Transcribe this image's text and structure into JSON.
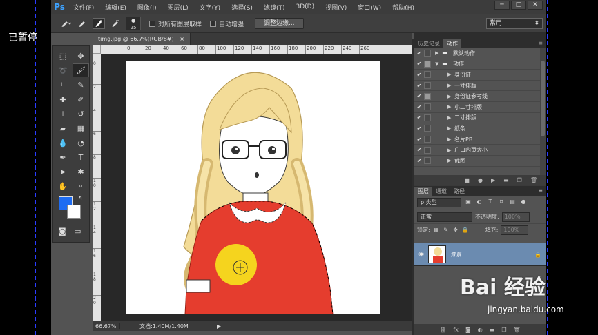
{
  "recorder": {
    "status_label": "已暂停"
  },
  "app": {
    "logo": "Ps"
  },
  "menu": [
    "文件(F)",
    "编辑(E)",
    "图像(I)",
    "图层(L)",
    "文字(Y)",
    "选择(S)",
    "滤镜(T)",
    "3D(D)",
    "视图(V)",
    "窗口(W)",
    "帮助(H)"
  ],
  "window_controls": {
    "minimize": "─",
    "maximize": "□",
    "close": "✕"
  },
  "options": {
    "brush_size": "25",
    "sample_all_layers": "对所有图层取样",
    "auto_enhance": "自动增强",
    "refine_edge": "调整边缘...",
    "workspace": "常用"
  },
  "document": {
    "tab_title": "timg.jpg @ 66.7%(RGB/8#)",
    "tab_close": "×",
    "ruler_h": [
      "0",
      "20",
      "40",
      "60",
      "80",
      "100",
      "120",
      "140",
      "160",
      "180",
      "200",
      "220",
      "240",
      "260"
    ],
    "ruler_v": [
      "0",
      "2",
      "4",
      "6",
      "8",
      "1\n0",
      "1\n2",
      "1\n4",
      "1\n6",
      "1\n8",
      "2\n0"
    ],
    "zoom": "66.67%",
    "doc_size": "文档:1.40M/1.40M"
  },
  "history_actions_panel": {
    "tabs": [
      "历史记录",
      "动作"
    ],
    "active_tab": 1,
    "items": [
      {
        "label": "默认动作",
        "type": "folder",
        "expanded": false,
        "checked": true,
        "dialog": false
      },
      {
        "label": "动作",
        "type": "folder",
        "expanded": true,
        "checked": true,
        "dialog": true
      },
      {
        "label": "身份证",
        "type": "action",
        "checked": true,
        "dialog": false
      },
      {
        "label": "一寸排版",
        "type": "action",
        "checked": true,
        "dialog": false
      },
      {
        "label": "身份证参考线",
        "type": "action",
        "checked": true,
        "dialog": true
      },
      {
        "label": "小二寸排版",
        "type": "action",
        "checked": true,
        "dialog": false
      },
      {
        "label": "二寸排版",
        "type": "action",
        "checked": true,
        "dialog": false
      },
      {
        "label": "纸条",
        "type": "action",
        "checked": true,
        "dialog": false
      },
      {
        "label": "名片PB",
        "type": "action",
        "checked": true,
        "dialog": false
      },
      {
        "label": "户口内页大小",
        "type": "action",
        "checked": true,
        "dialog": false
      },
      {
        "label": "截图",
        "type": "action",
        "checked": true,
        "dialog": false
      }
    ]
  },
  "layers_panel": {
    "tabs": [
      "图层",
      "通道",
      "路径"
    ],
    "active_tab": 0,
    "kind_filter": "ρ 类型",
    "blend_mode": "正常",
    "opacity_label": "不透明度:",
    "opacity_value": "100%",
    "lock_label": "锁定:",
    "fill_label": "填充:",
    "fill_value": "100%",
    "layer_name": "背景"
  },
  "watermark": {
    "logo": "Bai 经验",
    "url": "jingyan.baidu.com"
  },
  "colors": {
    "foreground": "#1e6cf2",
    "background": "#ffffff",
    "accent": "#6b8bb0"
  }
}
